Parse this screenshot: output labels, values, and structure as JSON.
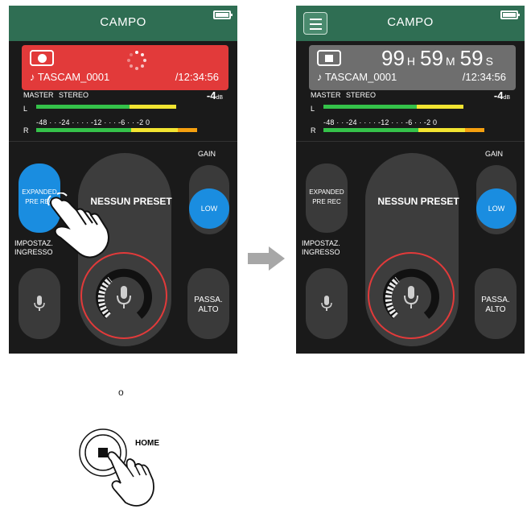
{
  "app": {
    "title": "CAMPO"
  },
  "left_screen": {
    "filename": "♪ TASCAM_0001",
    "rec_time": "/12:34:56",
    "meter": {
      "master": "MASTER",
      "stereo": "STEREO",
      "level": "-4",
      "level_unit": "dB",
      "ch_l": "L",
      "ch_r": "R",
      "scale": "-48 · · -24 · · · · -12 · · · -6 · · -2 0"
    },
    "buttons": {
      "expanded_line1": "EXPANDED",
      "expanded_line2": "PRE REC",
      "preset": "NESSUN PRESET",
      "gain_label": "GAIN",
      "gain_value": "LOW",
      "impostaz_line1": "IMPOSTAZ.",
      "impostaz_line2": "INGRESSO",
      "passa_line1": "PASSA.",
      "passa_line2": "ALTO"
    }
  },
  "right_screen": {
    "timer": {
      "hours": "99",
      "h_unit": "H",
      "minutes": "59",
      "m_unit": "M",
      "seconds": "59",
      "s_unit": "S"
    },
    "filename": "♪ TASCAM_0001",
    "rec_time": "/12:34:56",
    "meter": {
      "master": "MASTER",
      "stereo": "STEREO",
      "level": "-4",
      "level_unit": "dB",
      "ch_l": "L",
      "ch_r": "R",
      "scale": "-48 · · -24 · · · · -12 · · · -6 · · -2 0"
    },
    "buttons": {
      "expanded_line1": "EXPANDED",
      "expanded_line2": "PRE REC",
      "preset": "NESSUN PRESET",
      "gain_label": "GAIN",
      "gain_value": "LOW",
      "impostaz_line1": "IMPOSTAZ.",
      "impostaz_line2": "INGRESSO",
      "passa_line1": "PASSA.",
      "passa_line2": "ALTO"
    }
  },
  "separator": "o",
  "home_button": {
    "label": "HOME"
  },
  "colors": {
    "title_bar": "#2f6e53",
    "rec_red": "#e23a3a",
    "stop_gray": "#6e6e6e",
    "accent_blue": "#1a8de0",
    "meter_green": "#35c24a",
    "meter_yellow": "#f2e431",
    "meter_orange": "#f5a00f"
  },
  "icons": [
    "battery-icon",
    "record-icon",
    "stop-icon",
    "spinner-icon",
    "menu-icon",
    "mic-icon",
    "tap-hand-icon",
    "arrow-right-icon",
    "home-button-icon"
  ]
}
